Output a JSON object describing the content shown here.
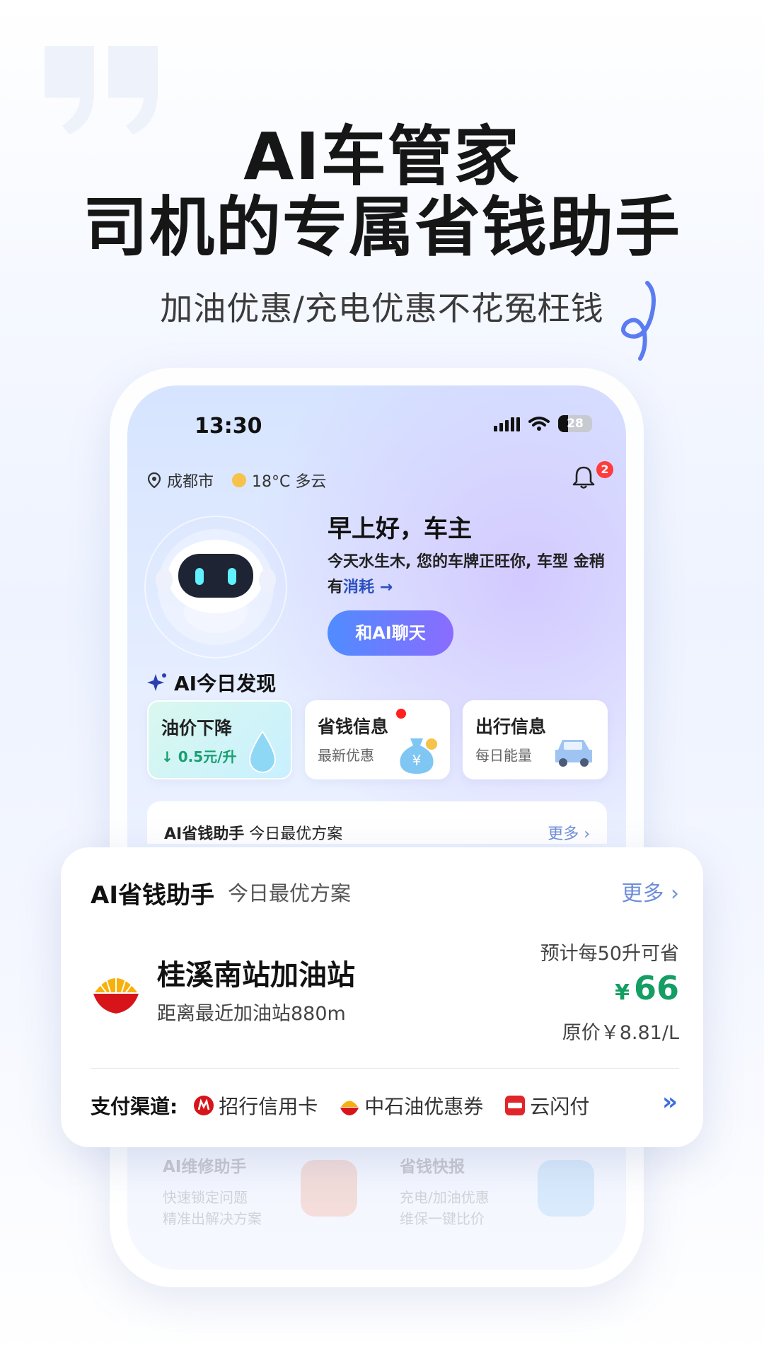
{
  "hero": {
    "title_line1": "AI车管家",
    "title_line2": "司机的专属省钱助手",
    "subtitle": "加油优惠/充电优惠不花冤枉钱"
  },
  "phone": {
    "status": {
      "time": "13:30",
      "battery": "28"
    },
    "location": {
      "city": "成都市",
      "weather": "18°C 多云",
      "notifications": "2"
    },
    "greeting": "早上好，车主",
    "fortune_part1": "今天水生木, 您的车牌正旺你, 车型",
    "fortune_part2": "金稍有",
    "fortune_hl": "消耗",
    "chat_button": "和AI聊天",
    "discovery": {
      "title": "AI今日发现",
      "cards": [
        {
          "title": "油价下降",
          "sub": "0.5元/升"
        },
        {
          "title": "省钱信息",
          "sub": "最新优惠"
        },
        {
          "title": "出行信息",
          "sub": "每日能量"
        }
      ]
    },
    "mini_card": {
      "title": "AI省钱助手",
      "sub": "今日最优方案",
      "more": "更多 ›"
    },
    "faded_cards": [
      {
        "title": "AI维修助手",
        "line1": "快速锁定问题",
        "line2": "精准出解决方案"
      },
      {
        "title": "省钱快报",
        "line1": "充电/加油优惠",
        "line2": "维保一键比价"
      }
    ]
  },
  "card": {
    "title": "AI省钱助手",
    "subtitle": "今日最优方案",
    "more": "更多 ›",
    "station": "桂溪南站加油站",
    "distance": "距离最近加油站880m",
    "estimate": "预计每50升可省",
    "currency": "¥",
    "saving": "66",
    "original": "原价￥8.81/L",
    "pay_label": "支付渠道:",
    "pay": [
      "招行信用卡",
      "中石油优惠券",
      "云闪付"
    ],
    "pay_more": "»"
  },
  "colors": {
    "accent": "#4f8cff",
    "save_green": "#149e63",
    "brand_purple": "#8a6cff"
  }
}
